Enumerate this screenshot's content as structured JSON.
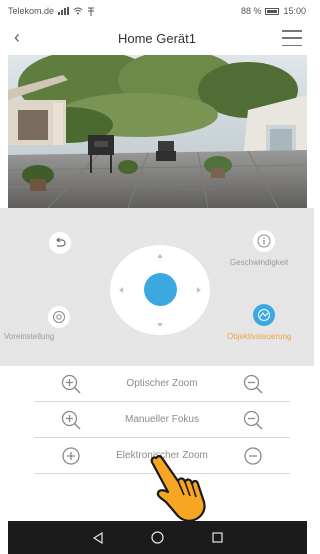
{
  "status_bar": {
    "carrier": "Telekom.de",
    "battery": "88 %",
    "time": "15:00"
  },
  "header": {
    "title": "Home Gerät1"
  },
  "controls": {
    "speed_label": "Geschwindigkeit",
    "preset_label": "Voreinstellung",
    "lens_label": "Objektivsteuerung",
    "active_color": "#f0a340",
    "dpad_color": "#3ba9e0"
  },
  "lens_rows": [
    {
      "label": "Optischer Zoom"
    },
    {
      "label": "Manueller Fokus"
    },
    {
      "label": "Elektronischer Zoom"
    }
  ],
  "icons": {
    "back": "chevron-left-icon",
    "menu": "hamburger-menu-icon",
    "undo": "undo-arrow-icon",
    "speed": "info-icon",
    "preset": "target-icon",
    "lens": "lens-icon",
    "zoom_in": "magnifier-plus-icon",
    "zoom_out": "magnifier-minus-icon",
    "plus": "plus-circle-icon",
    "minus": "minus-circle-icon",
    "gesture": "tap-hand-icon"
  }
}
